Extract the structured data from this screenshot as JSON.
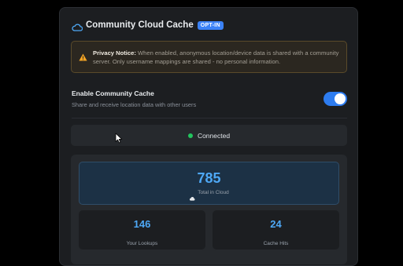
{
  "header": {
    "title": "Community Cloud Cache",
    "badge": "OPT-IN",
    "icon": "cloud-icon"
  },
  "notice": {
    "icon": "warning-icon",
    "label": "Privacy Notice:",
    "text": " When enabled, anonymous location/device data is shared with a community server. Only username mappings are shared - no personal information."
  },
  "setting": {
    "label": "Enable Community Cache",
    "description": "Share and receive location data with other users",
    "enabled": true
  },
  "status": {
    "text": "Connected",
    "color": "#22c55e"
  },
  "stats": {
    "total": {
      "value": "785",
      "label": "Total in Cloud"
    },
    "lookups": {
      "value": "146",
      "label": "Your Lookups"
    },
    "hits": {
      "value": "24",
      "label": "Cache Hits"
    }
  },
  "colors": {
    "accent": "#3b82f6",
    "stat_value": "#4ea8f5",
    "panel_bg": "#1c1e21"
  }
}
